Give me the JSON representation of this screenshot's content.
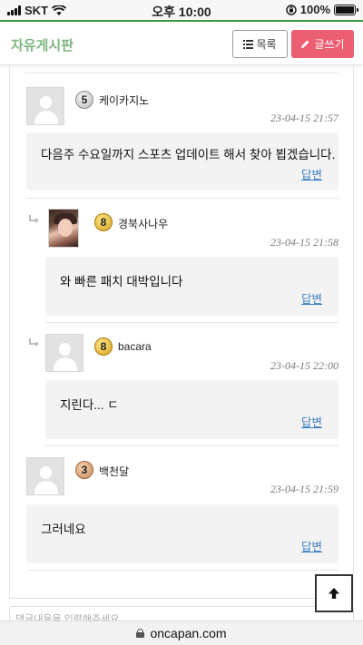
{
  "status_bar": {
    "carrier": "SKT",
    "time": "오후 10:00",
    "battery": "100%"
  },
  "header": {
    "title": "자유게시판",
    "list_button": "목록",
    "write_button": "글쓰기"
  },
  "comments": [
    {
      "nickname": "케이카지노",
      "level": "5",
      "date": "23-04-15 21:57",
      "text": "다음주 수요일까지 스포츠 업데이트 해서 찾아 뵙겠습니다.",
      "reply_label": "답변"
    },
    {
      "nickname": "경북사나우",
      "level": "8",
      "date": "23-04-15 21:58",
      "text": "와 빠른 패치 대박입니다",
      "reply_label": "답변"
    },
    {
      "nickname": "bacara",
      "level": "8",
      "date": "23-04-15 22:00",
      "text": "지린다... ㄷ",
      "reply_label": "답변"
    },
    {
      "nickname": "백천달",
      "level": "3",
      "date": "23-04-15 21:59",
      "text": "그러네요",
      "reply_label": "답변"
    }
  ],
  "comment_input": {
    "placeholder": "댓글내용을 입력해주세요"
  },
  "url_bar": {
    "domain": "oncapan.com"
  },
  "icons": {
    "list": "list-icon",
    "write": "pencil-icon",
    "reply_indent": "reply-arrow-icon",
    "scroll_top": "arrow-up-icon",
    "lock": "lock-icon"
  },
  "colors": {
    "accent_green": "#7fb67f",
    "write_button": "#ec5f72",
    "link": "#3b7fc4"
  }
}
